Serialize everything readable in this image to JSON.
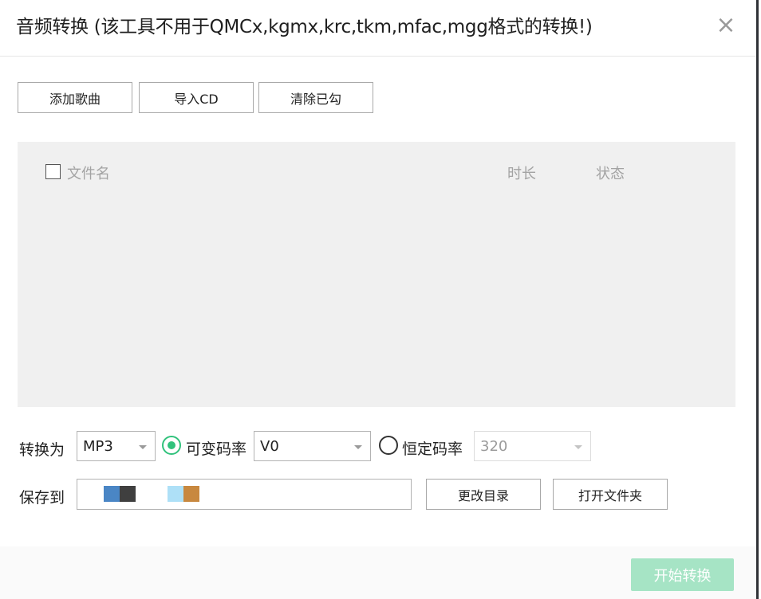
{
  "dialog": {
    "title": "音频转换 (该工具不用于QMCx,kgmx,krc,tkm,mfac,mgg格式的转换!)",
    "close_symbol": "×"
  },
  "toolbar": {
    "add_songs": "添加歌曲",
    "import_cd": "导入CD",
    "clear_checked": "清除已勾"
  },
  "file_list": {
    "columns": {
      "name": "文件名",
      "duration": "时长",
      "status": "状态"
    },
    "select_all_checked": false,
    "rows": []
  },
  "convert": {
    "label": "转换为",
    "format_value": "MP3",
    "vbr_label": "可变码率",
    "vbr_selected": true,
    "vbr_value": "V0",
    "cbr_label": "恒定码率",
    "cbr_selected": false,
    "cbr_value": "320"
  },
  "save": {
    "label": "保存到",
    "path_blocks": [
      "#4a86c5",
      "#3f3f3f",
      "#aee0f7",
      "#c8883f"
    ],
    "change_dir": "更改目录",
    "open_folder": "打开文件夹"
  },
  "footer": {
    "start": "开始转换"
  },
  "colors": {
    "accent": "#31c27c",
    "start_disabled": "#a6e4c5"
  },
  "icons": {
    "close": "close-icon",
    "dropdown": "chevron-down-icon"
  }
}
